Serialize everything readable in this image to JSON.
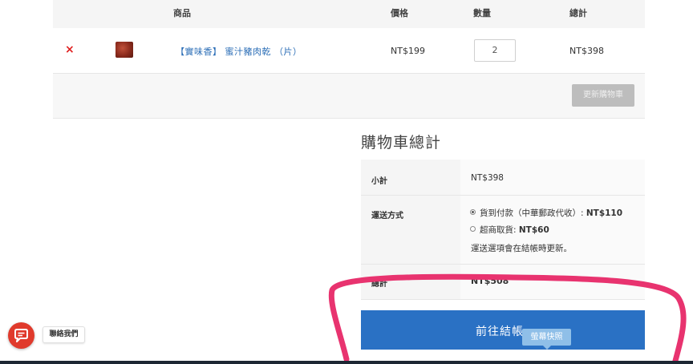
{
  "cart": {
    "headers": {
      "product": "商品",
      "price": "價格",
      "quantity": "數量",
      "total": "總計"
    },
    "item": {
      "remove_symbol": "×",
      "name": "【實味香】 蜜汁豬肉乾 （片）",
      "price": "NT$199",
      "quantity": "2",
      "subtotal": "NT$398"
    },
    "update_button": "更新購物車"
  },
  "totals": {
    "title": "購物車總計",
    "subtotal_label": "小計",
    "subtotal_value": "NT$398",
    "shipping_label": "運送方式",
    "shipping_options": [
      {
        "label": "貨到付款（中華郵政代收）: ",
        "price": "NT$110",
        "selected": true
      },
      {
        "label": "超商取貨: ",
        "price": "NT$60",
        "selected": false
      }
    ],
    "shipping_note": "運送選項會在結帳時更新。",
    "total_label": "總計",
    "total_value": "NT$508"
  },
  "checkout_button": "前往結帳",
  "tooltip": "螢幕快照",
  "chat": {
    "label": "聯絡我們",
    "icon": "chat-bubble-icon",
    "color": "#e03a2c"
  },
  "colors": {
    "accent": "#2a71c4",
    "link": "#2a6db6",
    "remove": "#e02020",
    "annotation": "#e8336f"
  }
}
